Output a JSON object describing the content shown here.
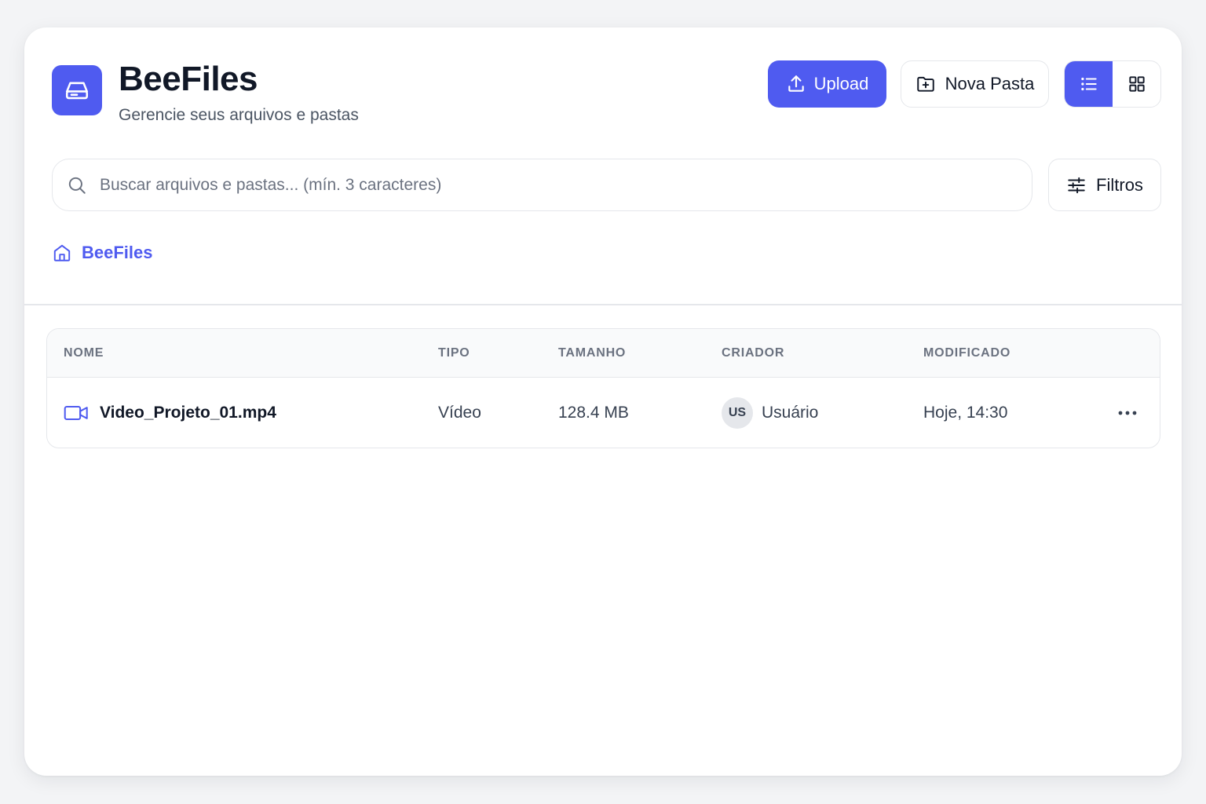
{
  "app": {
    "title": "BeeFiles",
    "subtitle": "Gerencie seus arquivos e pastas",
    "logo_icon": "drive-icon",
    "accent_color": "#4f5bf0"
  },
  "toolbar": {
    "upload_label": "Upload",
    "upload_icon": "upload-icon",
    "new_folder_label": "Nova Pasta",
    "new_folder_icon": "folder-plus-icon",
    "view_modes": [
      {
        "name": "list",
        "icon": "list-icon",
        "active": true
      },
      {
        "name": "grid",
        "icon": "grid-icon",
        "active": false
      }
    ]
  },
  "search": {
    "placeholder": "Buscar arquivos e pastas... (mín. 3 caracteres)",
    "value": "",
    "icon": "search-icon"
  },
  "filters": {
    "label": "Filtros",
    "icon": "sliders-icon"
  },
  "breadcrumb": {
    "items": [
      {
        "label": "BeeFiles",
        "icon": "home-icon"
      }
    ]
  },
  "table": {
    "columns": [
      "NOME",
      "TIPO",
      "TAMANHO",
      "CRIADOR",
      "MODIFICADO"
    ],
    "rows": [
      {
        "name": "Video_Projeto_01.mp4",
        "icon": "video-icon",
        "type": "Vídeo",
        "size": "128.4 MB",
        "creator_initials": "US",
        "creator": "Usuário",
        "modified": "Hoje, 14:30",
        "actions_icon": "more-horizontal-icon"
      }
    ]
  }
}
